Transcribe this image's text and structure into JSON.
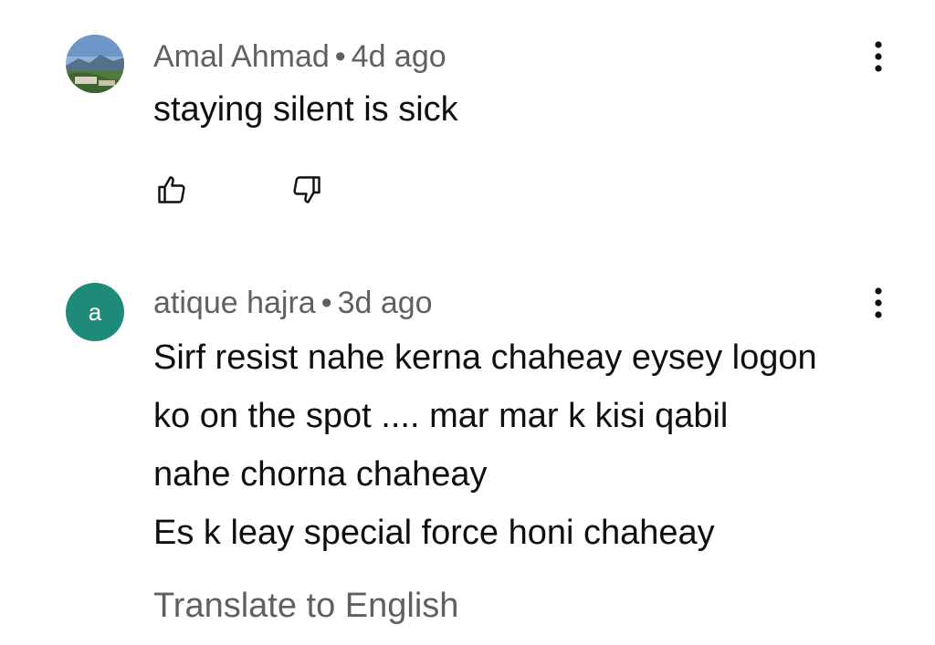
{
  "comments": [
    {
      "author": "Amal Ahmad",
      "separator": "•",
      "time": "4d ago",
      "lines": [
        "staying silent is sick"
      ],
      "avatar_icon": "landscape-photo-avatar"
    },
    {
      "author": "atique hajra",
      "separator": "•",
      "time": "3d ago",
      "avatar_letter": "a",
      "avatar_color": "#1e8a78",
      "lines": [
        "Sirf resist nahe kerna chaheay  eysey logon",
        "ko on the spot  .... mar mar k kisi qabil",
        "nahe chorna chaheay",
        "Es k leay special force honi chaheay"
      ],
      "translate_label": "Translate to English"
    }
  ],
  "icons": {
    "like": "thumbs-up-icon",
    "dislike": "thumbs-down-icon",
    "more": "more-vertical-icon"
  }
}
